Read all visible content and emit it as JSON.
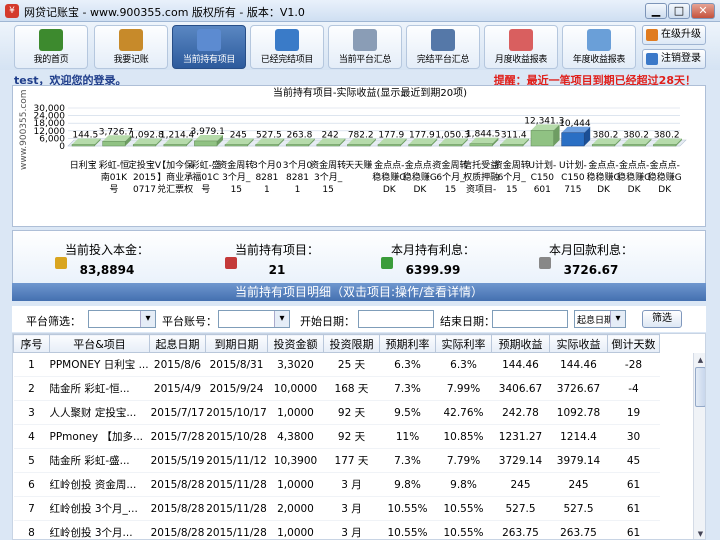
{
  "window": {
    "title": "网贷记账宝 - www.900355.com 版权所有 - 版本：V1.0"
  },
  "toolbar": {
    "buttons": [
      {
        "label": "我的首页",
        "icon": "home-icon",
        "color": "#3d8a2e"
      },
      {
        "label": "我要记账",
        "icon": "pen-icon",
        "color": "#c78a2a"
      },
      {
        "label": "当前持有项目",
        "icon": "list-icon",
        "color": "#5c8bd1"
      },
      {
        "label": "已经完结项目",
        "icon": "folder-icon",
        "color": "#3a7bc8"
      },
      {
        "label": "当前平台汇总",
        "icon": "chart-icon",
        "color": "#8a9db6"
      },
      {
        "label": "完结平台汇总",
        "icon": "calendar-icon",
        "color": "#5578a8"
      },
      {
        "label": "月度收益报表",
        "icon": "report-icon",
        "color": "#d95f5f"
      },
      {
        "label": "年度收益报表",
        "icon": "report-icon",
        "color": "#6a9fd8"
      }
    ],
    "upgrade": "在级升级",
    "logout": "注销登录"
  },
  "welcome": "test，欢迎您的登录。",
  "reminder": "提醒：最近一笔项目到期已经超过28天！",
  "watermark": "www.900355.com",
  "chart_data": {
    "type": "bar",
    "title": "当前持有项目-实际收益(显示最近到期20项)",
    "ylim": [
      0,
      30000
    ],
    "yticks": [
      "30,000",
      "24,000",
      "18,000",
      "12,000",
      "6,000",
      "0"
    ],
    "categories": [
      "日利宝",
      "彩虹-恒南01K号",
      "定投宝V20150717",
      "【加今保】商业承兑汇票权",
      "彩虹-盛福01C号",
      "资金周转3个月_15",
      "3个月082811",
      "3个月082811",
      "资金周转3个月_15",
      "天天赚",
      "金点点-稳稳赚GDK",
      "金点点-稳稳赚GDK",
      "资金周转6个月_15",
      "信托受益权质押融资项目-",
      "资金周转6个月_15",
      "U计划-C150601",
      "U计划-C150715",
      "金点点-稳稳赚GDK",
      "金点点-稳稳赚GDK",
      "金点点-稳稳赚GDK"
    ],
    "values": [
      144.5,
      3726.7,
      1092.8,
      1214.4,
      3979.1,
      245,
      527.5,
      263.8,
      242,
      782.2,
      177.9,
      177.9,
      1050.3,
      1844.5,
      311.4,
      12341.3,
      10444,
      380.2,
      380.2,
      380.2
    ],
    "labels": [
      "144.5",
      "3,726.7",
      "1,092.8",
      "1,214.4",
      "3,979.1",
      "245",
      "527.5",
      "263.8",
      "242",
      "782.2",
      "177.9",
      "177.9",
      "1,050.3",
      "1,844.5",
      "311.4",
      "12,341.3",
      "10,444",
      "380.2",
      "380.2",
      "380.2"
    ],
    "highlight_index": 16,
    "bar_color": "#90c283",
    "highlight_color": "#2a6fc4",
    "xlabel": "",
    "ylabel": ""
  },
  "stats": [
    {
      "label": "当前投入本金：",
      "value": "83,8894",
      "icon": "coins-icon",
      "color": "#d9a520"
    },
    {
      "label": "当前持有项目：",
      "value": "21",
      "icon": "bar-chart-icon",
      "color": "#c43a3a"
    },
    {
      "label": "本月持有利息：",
      "value": "6399.99",
      "icon": "list-icon",
      "color": "#3a9c3a"
    },
    {
      "label": "本月回款利息：",
      "value": "3726.67",
      "icon": "calculator-icon",
      "color": "#888888"
    }
  ],
  "detail_title": "当前持有项目明细（双击项目:操作/查看详情）",
  "filters": {
    "platform_label": "平台筛选：",
    "account_label": "平台账号：",
    "start_label": "开始日期：",
    "end_label": "结束日期：",
    "sort_value": "起息日期",
    "filter_button": "筛选"
  },
  "table": {
    "headers": [
      "序号",
      "平台&项目",
      "起息日期",
      "到期日期",
      "投资金额",
      "投资限期",
      "预期利率",
      "实际利率",
      "预期收益",
      "实际收益",
      "倒计天数"
    ],
    "rows": [
      [
        "1",
        "PPMONEY 日利宝 ...",
        "2015/8/6",
        "2015/8/31",
        "3,3020",
        "25 天",
        "6.3%",
        "6.3%",
        "144.46",
        "144.46",
        "-28"
      ],
      [
        "2",
        "陆金所 彩虹-恒...",
        "2015/4/9",
        "2015/9/24",
        "10,0000",
        "168 天",
        "7.3%",
        "7.99%",
        "3406.67",
        "3726.67",
        "-4"
      ],
      [
        "3",
        "人人聚财 定投宝...",
        "2015/7/17",
        "2015/10/17",
        "1,0000",
        "92 天",
        "9.5%",
        "42.76%",
        "242.78",
        "1092.78",
        "19"
      ],
      [
        "4",
        "PPmoney 【加多...",
        "2015/7/28",
        "2015/10/28",
        "4,3800",
        "92 天",
        "11%",
        "10.85%",
        "1231.27",
        "1214.4",
        "30"
      ],
      [
        "5",
        "陆金所 彩虹-盛...",
        "2015/5/19",
        "2015/11/12",
        "10,3900",
        "177 天",
        "7.3%",
        "7.79%",
        "3729.14",
        "3979.14",
        "45"
      ],
      [
        "6",
        "红岭创投 资金周...",
        "2015/8/28",
        "2015/11/28",
        "1,0000",
        "3 月",
        "9.8%",
        "9.8%",
        "245",
        "245",
        "61"
      ],
      [
        "7",
        "红岭创投 3个月_...",
        "2015/8/28",
        "2015/11/28",
        "2,0000",
        "3 月",
        "10.55%",
        "10.55%",
        "527.5",
        "527.5",
        "61"
      ],
      [
        "8",
        "红岭创投 3个月...",
        "2015/8/28",
        "2015/11/28",
        "1,0000",
        "3 月",
        "10.55%",
        "10.55%",
        "263.75",
        "263.75",
        "61"
      ]
    ]
  }
}
